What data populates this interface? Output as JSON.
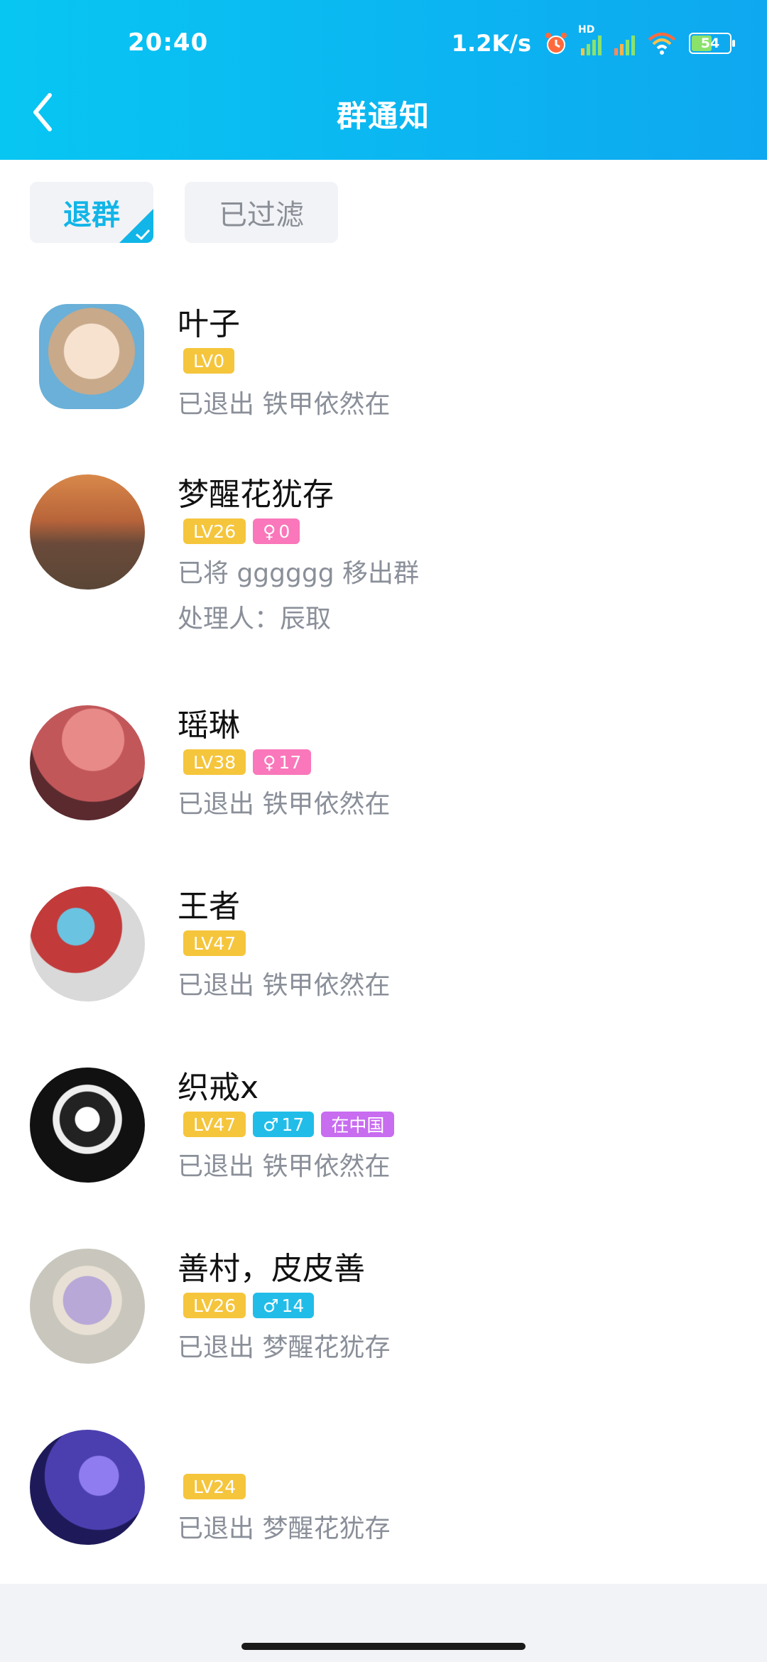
{
  "status_bar": {
    "time": "20:40",
    "net_speed": "1.2K/s",
    "battery": "54",
    "hd_label": "HD"
  },
  "header": {
    "title": "群通知"
  },
  "tabs": [
    {
      "label": "退群",
      "active": true
    },
    {
      "label": "已过滤",
      "active": false
    }
  ],
  "items": [
    {
      "name": "叶子",
      "badges": [
        {
          "type": "lv",
          "text": "LV0"
        }
      ],
      "lines": [
        "已退出 铁甲依然在"
      ]
    },
    {
      "name": "梦醒花犹存",
      "badges": [
        {
          "type": "lv",
          "text": "LV26"
        },
        {
          "type": "female",
          "text": "0"
        }
      ],
      "lines": [
        "已将 gggggg 移出群",
        "处理人：辰取"
      ]
    },
    {
      "name": "瑶琳",
      "badges": [
        {
          "type": "lv",
          "text": "LV38"
        },
        {
          "type": "female",
          "text": "17"
        }
      ],
      "lines": [
        "已退出 铁甲依然在"
      ]
    },
    {
      "name": "王者",
      "badges": [
        {
          "type": "lv",
          "text": "LV47"
        }
      ],
      "lines": [
        "已退出 铁甲依然在"
      ]
    },
    {
      "name": "织戒x",
      "badges": [
        {
          "type": "lv",
          "text": "LV47"
        },
        {
          "type": "male",
          "text": "17"
        },
        {
          "type": "location",
          "text": "在中国"
        }
      ],
      "lines": [
        "已退出 铁甲依然在"
      ]
    },
    {
      "name": "善村，皮皮善",
      "badges": [
        {
          "type": "lv",
          "text": "LV26"
        },
        {
          "type": "male",
          "text": "14"
        }
      ],
      "lines": [
        "已退出 梦醒花犹存"
      ]
    },
    {
      "name": "",
      "badges": [
        {
          "type": "lv",
          "text": "LV24"
        }
      ],
      "lines": [
        "已退出 梦醒花犹存"
      ]
    }
  ],
  "colors": {
    "header_start": "#08c6f2",
    "header_end": "#0ea8f0",
    "lv_badge": "#f5c53c",
    "female_badge": "#f977ba",
    "male_badge": "#21bde8",
    "location_badge": "#c86cf0"
  }
}
